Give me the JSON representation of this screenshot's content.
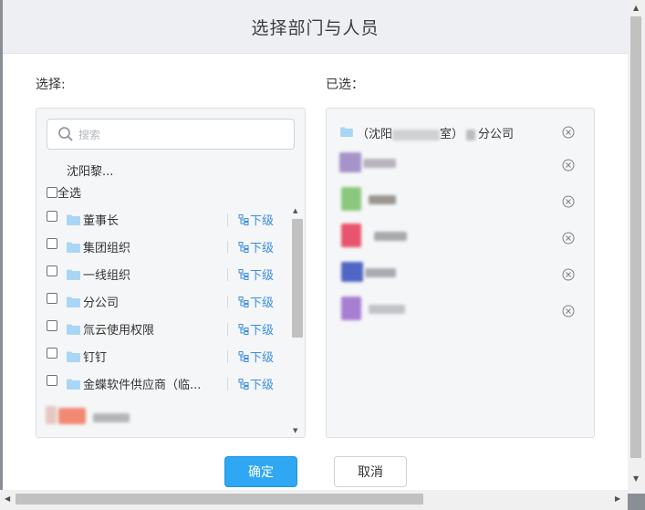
{
  "dialog": {
    "title": "选择部门与人员",
    "left_label": "选择:",
    "right_label": "已选：",
    "search_placeholder": "搜索",
    "path": "沈阳黎...",
    "select_all": "全选",
    "sub_label": "下级",
    "rows": [
      {
        "label": "董事长"
      },
      {
        "label": "集团组织"
      },
      {
        "label": "一线组织"
      },
      {
        "label": "分公司"
      },
      {
        "label": "氚云使用权限"
      },
      {
        "label": "钉钉"
      },
      {
        "label": "金蝶软件供应商（临..."
      }
    ],
    "selected_dept_prefix": "（沈阳",
    "selected_dept_mid": "室）",
    "selected_dept_suffix": "分公司",
    "confirm": "确定",
    "cancel": "取消"
  },
  "colors": {
    "accent": "#2fa7f2",
    "link": "#3a8ee6",
    "folder": "#a9d6f5"
  },
  "icons": [
    "search-icon",
    "folder-icon",
    "subordinate-icon",
    "remove-icon"
  ]
}
